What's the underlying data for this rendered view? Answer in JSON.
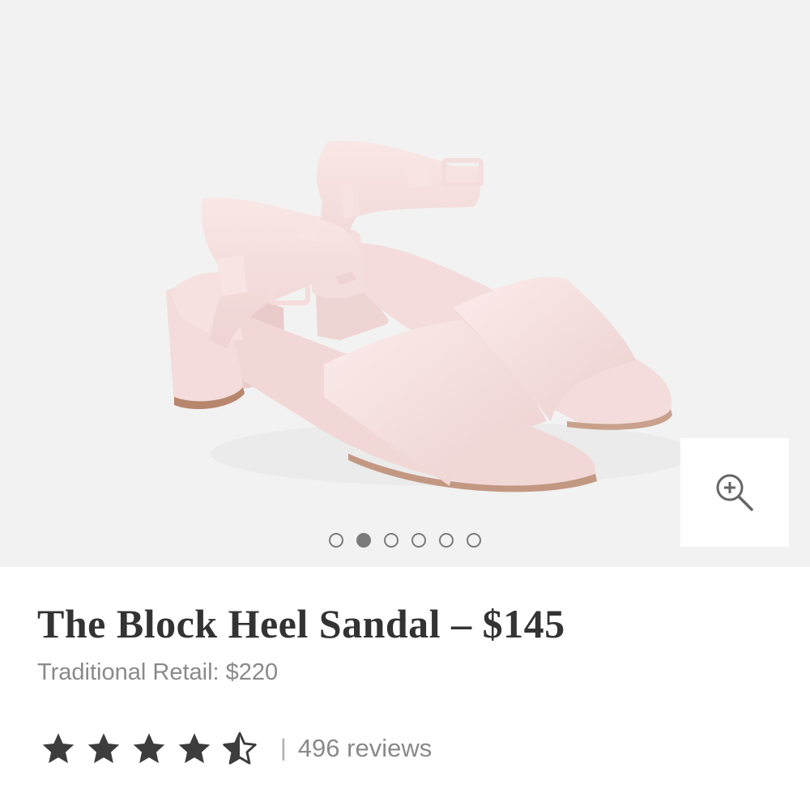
{
  "product": {
    "title": "The Block Heel Sandal – $145",
    "retail_price_label": "Traditional Retail: $220"
  },
  "gallery": {
    "image": "pink-block-heel-sandals-photo",
    "slide_count": 6,
    "active_slide": 2,
    "zoom_icon": "zoom-in-icon"
  },
  "rating": {
    "value": 4.5,
    "max": 5,
    "star_color": "#3d3d3d",
    "divider": "|",
    "reviews_label": "496 reviews"
  },
  "colors": {
    "sandal": "#f5dede",
    "background": "#f2f2f2",
    "title_text": "#333333",
    "muted_text": "#8a8a8a"
  }
}
